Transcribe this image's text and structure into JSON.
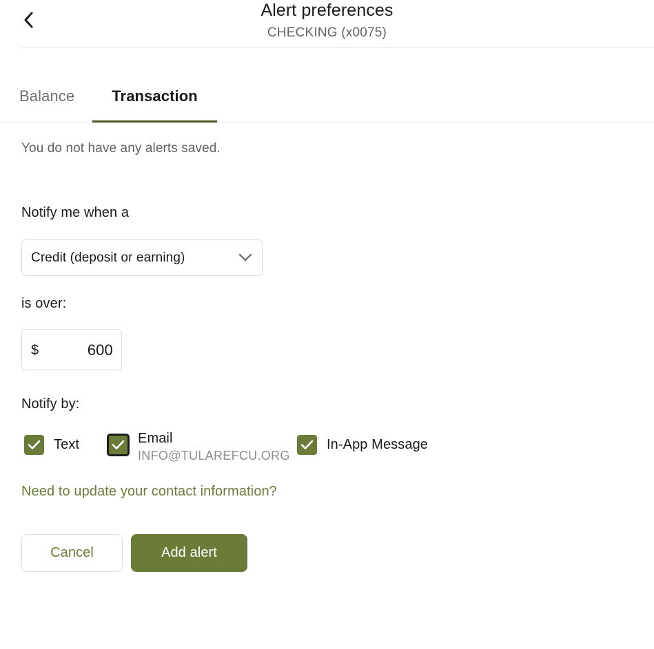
{
  "header": {
    "back_icon": "chevron-left-icon",
    "title": "Alert preferences",
    "subtitle": "CHECKING (x0075)"
  },
  "tabs": [
    {
      "label": "Balance",
      "active": false
    },
    {
      "label": "Transaction",
      "active": true
    }
  ],
  "content": {
    "empty_state": "You do not have any alerts saved.",
    "notify_when_label": "Notify me when a",
    "alert_type": {
      "value": "Credit (deposit or earning)",
      "chevron_icon": "chevron-down-icon"
    },
    "condition_label": "is over:",
    "amount": {
      "currency": "$",
      "value": "600"
    },
    "notify_by_label": "Notify by:",
    "notify_options": [
      {
        "label": "Text",
        "sublabel": "",
        "checked": true,
        "focused": false
      },
      {
        "label": "Email",
        "sublabel": "INFO@TULAREFCU.ORG",
        "checked": true,
        "focused": true
      },
      {
        "label": "In-App Message",
        "sublabel": "",
        "checked": true,
        "focused": false
      }
    ],
    "contact_link": "Need to update your contact information?"
  },
  "actions": {
    "cancel_label": "Cancel",
    "submit_label": "Add alert"
  },
  "colors": {
    "accent": "#6b7c39",
    "accent_dark": "#4c5a24",
    "text_primary": "#1a1a1a",
    "text_muted": "#5f6368",
    "border": "#dcdcdc"
  }
}
